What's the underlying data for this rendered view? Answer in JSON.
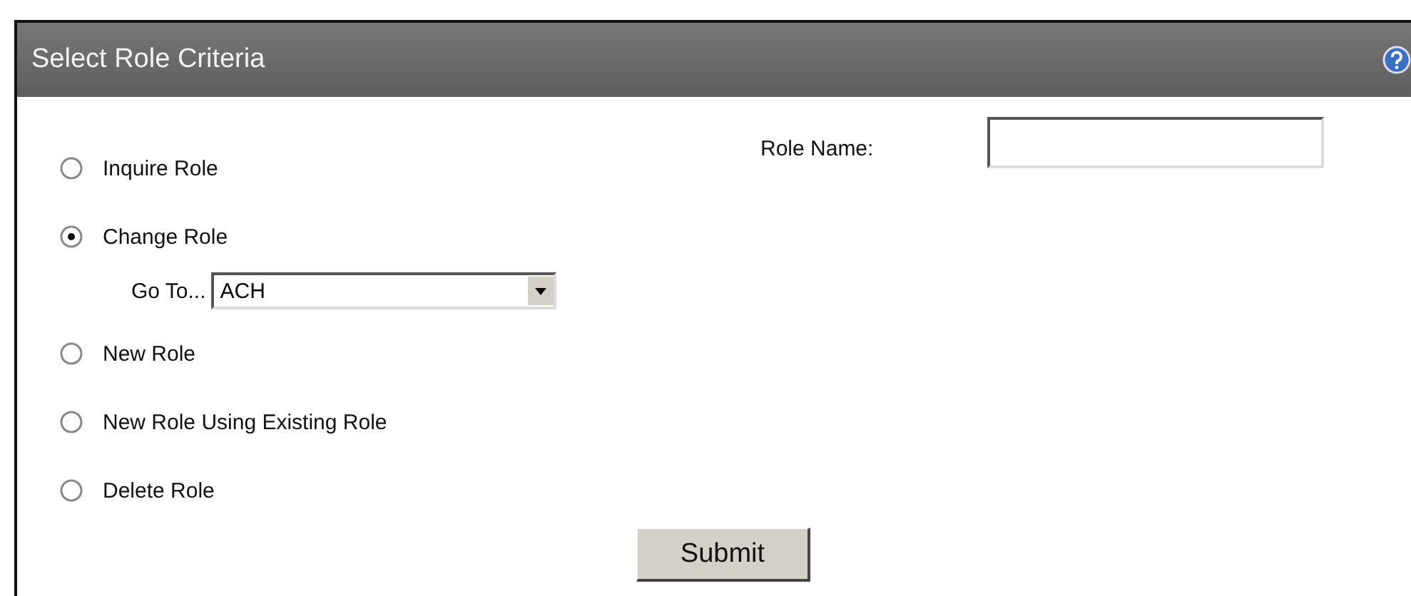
{
  "panel": {
    "title": "Select Role Criteria"
  },
  "options": [
    {
      "label": "Inquire Role",
      "selected": false
    },
    {
      "label": "Change Role",
      "selected": true,
      "goto": {
        "label": "Go To...",
        "value": "ACH"
      }
    },
    {
      "label": "New Role",
      "selected": false
    },
    {
      "label": "New Role Using Existing Role",
      "selected": false
    },
    {
      "label": "Delete Role",
      "selected": false
    }
  ],
  "role_name": {
    "label": "Role Name:"
  },
  "submit": "Submit"
}
